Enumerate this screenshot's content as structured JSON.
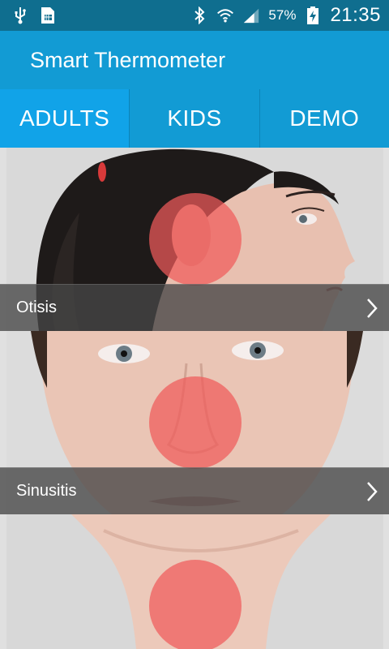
{
  "status_bar": {
    "icons": [
      "usb-icon",
      "sim-card-icon",
      "bluetooth-icon",
      "wifi-icon",
      "signal-icon",
      "battery-charging-icon"
    ],
    "battery_percent": "57%",
    "time": "21:35"
  },
  "app": {
    "title": "Smart Thermometer"
  },
  "tabs": [
    {
      "label": "ADULTS",
      "active": true
    },
    {
      "label": "KIDS",
      "active": false
    },
    {
      "label": "DEMO",
      "active": false
    }
  ],
  "sections": [
    {
      "label": "Otisis",
      "chevron_icon": "chevron-right-icon"
    },
    {
      "label": "Sinusitis",
      "chevron_icon": "chevron-right-icon"
    }
  ],
  "colors": {
    "status_bar": "#0f6e8f",
    "app_bar": "#129bd4",
    "tab_active": "#11a3e8",
    "hot_spot": "#f05a5a"
  }
}
